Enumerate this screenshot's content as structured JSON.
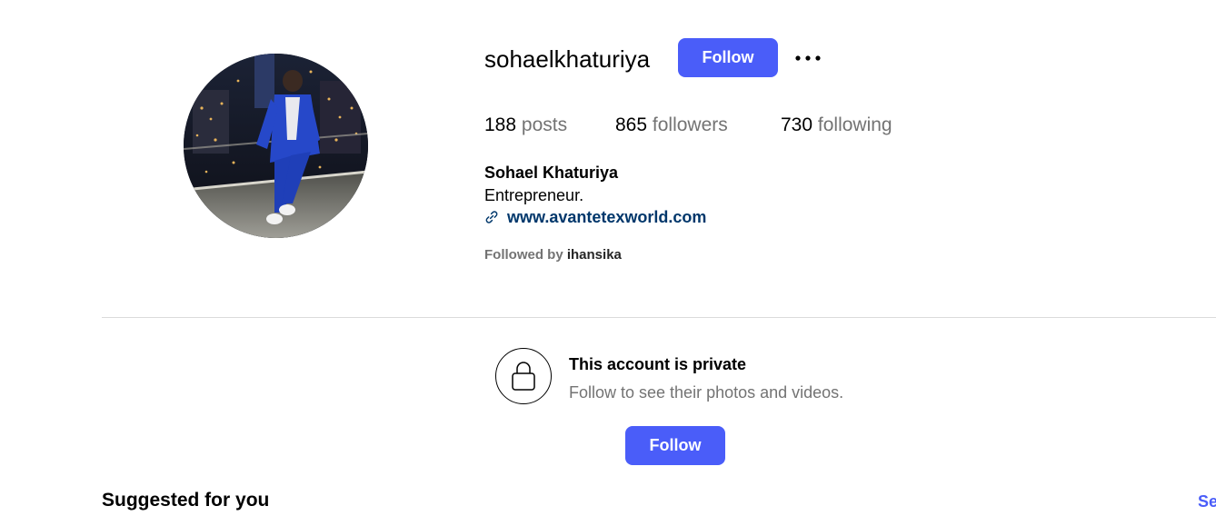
{
  "profile": {
    "username": "sohaelkhaturiya",
    "follow_label": "Follow",
    "more_icon": "more-options-icon",
    "stats": {
      "posts_count": "188",
      "posts_label": "posts",
      "followers_count": "865",
      "followers_label": "followers",
      "following_count": "730",
      "following_label": "following"
    },
    "full_name": "Sohael Khaturiya",
    "bio": "Entrepreneur.",
    "link_icon": "link-icon",
    "website": "www.avantetexworld.com",
    "followed_by_prefix": "Followed by",
    "followed_by_user": "ihansika"
  },
  "private_notice": {
    "icon": "lock-icon",
    "title": "This account is private",
    "subtitle": "Follow to see their photos and videos.",
    "follow_label": "Follow"
  },
  "suggested": {
    "title": "Suggested for you",
    "see_all_label": "Se"
  },
  "colors": {
    "button_blue": "#4a5df9",
    "link_blue": "#00376b",
    "muted_gray": "#737373",
    "divider": "#dbdbdb"
  }
}
